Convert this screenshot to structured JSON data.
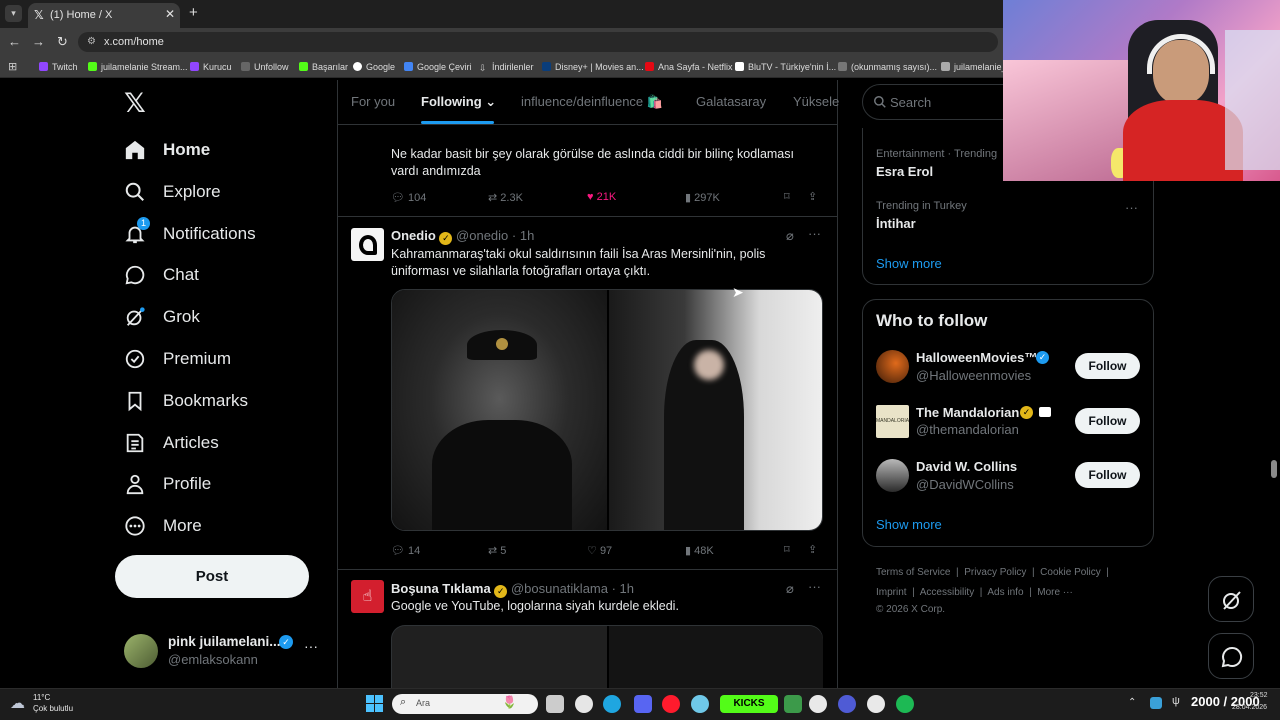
{
  "browser": {
    "tab_title": "(1) Home / X",
    "url": "x.com/home",
    "bookmarks": [
      "Twitch",
      "juilamelanie Stream...",
      "Kurucu",
      "Unfollow",
      "Başarılar",
      "Google",
      "Google Çeviri",
      "İndirilenler",
      "Disney+ | Movies an...",
      "Ana Sayfa - Netflix",
      "BluTV - Türkiye'nin İ...",
      "(okunmamış sayısı)...",
      "juilamelanie_c"
    ]
  },
  "nav": {
    "items": [
      "Home",
      "Explore",
      "Notifications",
      "Chat",
      "Grok",
      "Premium",
      "Bookmarks",
      "Articles",
      "Profile",
      "More"
    ],
    "notification_badge": "1",
    "post_label": "Post",
    "account_name": "pink juilamelani...",
    "account_handle": "@emlaksokann"
  },
  "feed": {
    "tabs": [
      "For you",
      "Following",
      "influence/deinfluence 🛍️",
      "Galatasaray",
      "Yüksele"
    ],
    "prev_tweet_text": "Ne kadar basit bir şey olarak görülse de aslında ciddi bir bilinç kodlaması vardı andımızda",
    "prev_metrics": {
      "replies": "104",
      "reposts": "2.3K",
      "likes": "21K",
      "views": "297K"
    },
    "tweet1": {
      "name": "Onedio",
      "handle": "@onedio",
      "time": "· 1h",
      "text": "Kahramanmaraş'taki okul saldırısının faili İsa Aras Mersinli'nin, polis üniforması ve silahlarla fotoğrafları ortaya çıktı.",
      "metrics": {
        "replies": "14",
        "reposts": "5",
        "likes": "97",
        "views": "48K"
      }
    },
    "tweet2": {
      "name": "Boşuna Tıklama",
      "handle": "@bosunatiklama",
      "time": "· 1h",
      "text": "Google ve YouTube, logolarına siyah kurdele ekledi."
    }
  },
  "right": {
    "search_placeholder": "Search",
    "trend1_context": "Entertainment · Trending",
    "trend1_name": "Esra Erol",
    "trend2_context": "Trending in Turkey",
    "trend2_name": "İntihar",
    "show_more": "Show more",
    "who_to_follow": "Who to follow",
    "follow_label": "Follow",
    "suggestions": [
      {
        "name": "HalloweenMovies™",
        "handle": "@Halloweenmovies"
      },
      {
        "name": "The Mandalorian",
        "handle": "@themandalorian"
      },
      {
        "name": "David W. Collins",
        "handle": "@DavidWCollins"
      }
    ],
    "footer_row1": [
      "Terms of Service",
      "Privacy Policy",
      "Cookie Policy"
    ],
    "footer_row2": [
      "Imprint",
      "Accessibility",
      "Ads info",
      "More ···"
    ],
    "copyright": "© 2026 X Corp."
  },
  "taskbar": {
    "weather_temp": "11°C",
    "weather_desc": "Çok bulutlu",
    "search_placeholder": "Ara",
    "counter": "2000 / 2000",
    "clock_time": "23:52",
    "clock_date": "28.04.2026"
  },
  "colors": {
    "accent": "#1d9bf0",
    "like": "#f91880",
    "gold": "#e2b719"
  }
}
